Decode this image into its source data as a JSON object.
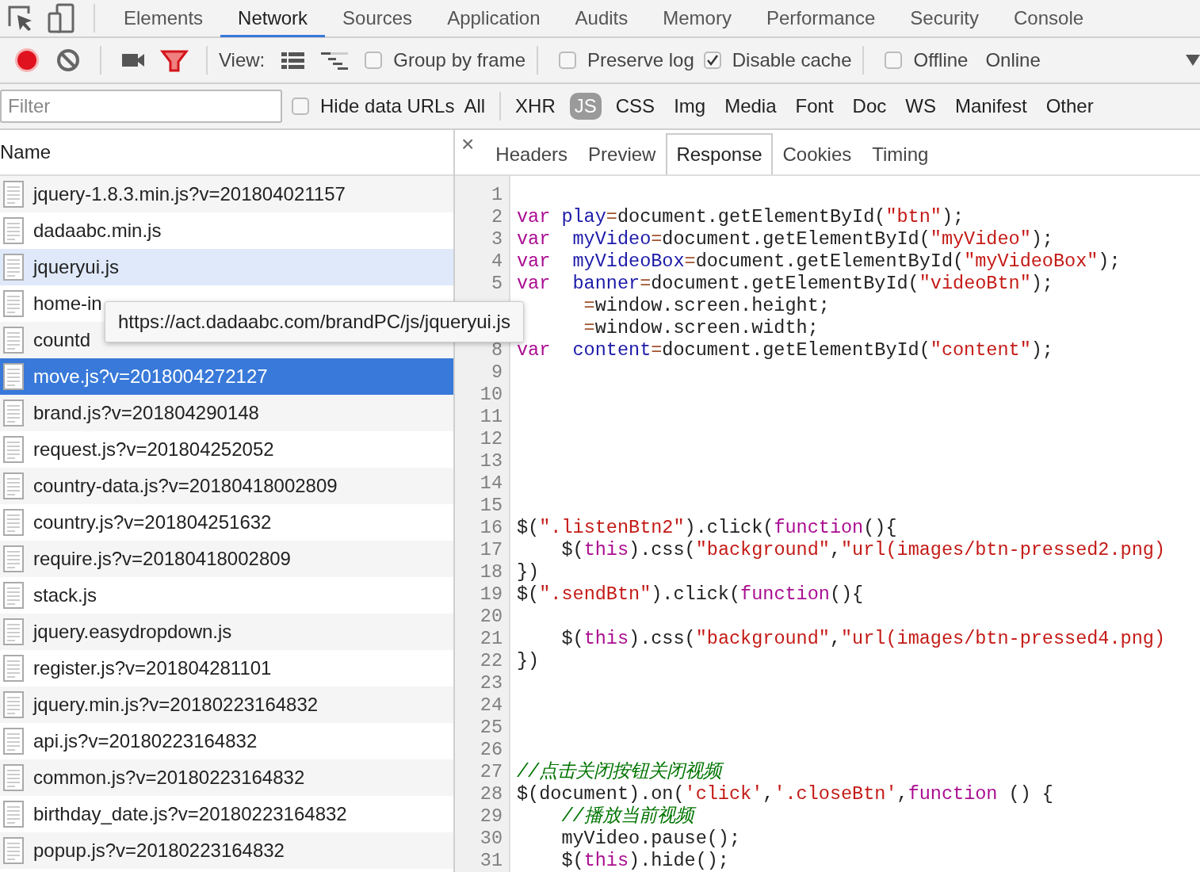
{
  "top_tabs": [
    {
      "label": "Elements",
      "selected": false
    },
    {
      "label": "Network",
      "selected": true
    },
    {
      "label": "Sources",
      "selected": false
    },
    {
      "label": "Application",
      "selected": false
    },
    {
      "label": "Audits",
      "selected": false
    },
    {
      "label": "Memory",
      "selected": false
    },
    {
      "label": "Performance",
      "selected": false
    },
    {
      "label": "Security",
      "selected": false
    },
    {
      "label": "Console",
      "selected": false
    }
  ],
  "toolbar": {
    "view_label": "View:",
    "checkboxes": [
      {
        "label": "Group by frame",
        "checked": false
      },
      {
        "label": "Preserve log",
        "checked": false
      },
      {
        "label": "Disable cache",
        "checked": true
      },
      {
        "label": "Offline",
        "checked": false
      }
    ],
    "throttle": "Online"
  },
  "filter": {
    "placeholder": "Filter",
    "hide_data_urls": {
      "label": "Hide data URLs",
      "checked": false
    },
    "types": [
      {
        "label": "All",
        "selected": false
      },
      {
        "label": "XHR",
        "selected": false
      },
      {
        "label": "JS",
        "selected": true
      },
      {
        "label": "CSS",
        "selected": false
      },
      {
        "label": "Img",
        "selected": false
      },
      {
        "label": "Media",
        "selected": false
      },
      {
        "label": "Font",
        "selected": false
      },
      {
        "label": "Doc",
        "selected": false
      },
      {
        "label": "WS",
        "selected": false
      },
      {
        "label": "Manifest",
        "selected": false
      },
      {
        "label": "Other",
        "selected": false
      }
    ]
  },
  "requests": {
    "column": "Name",
    "rows": [
      {
        "name": "jquery-1.8.3.min.js?v=201804021157",
        "selected": false,
        "hovered": false
      },
      {
        "name": "dadaabc.min.js",
        "selected": false,
        "hovered": false
      },
      {
        "name": "jqueryui.js",
        "selected": false,
        "hovered": true
      },
      {
        "name": "home-in",
        "selected": false,
        "hovered": false
      },
      {
        "name": "countd",
        "selected": false,
        "hovered": false
      },
      {
        "name": "move.js?v=2018004272127",
        "selected": true,
        "hovered": false
      },
      {
        "name": "brand.js?v=201804290148",
        "selected": false,
        "hovered": false
      },
      {
        "name": "request.js?v=201804252052",
        "selected": false,
        "hovered": false
      },
      {
        "name": "country-data.js?v=20180418002809",
        "selected": false,
        "hovered": false
      },
      {
        "name": "country.js?v=201804251632",
        "selected": false,
        "hovered": false
      },
      {
        "name": "require.js?v=20180418002809",
        "selected": false,
        "hovered": false
      },
      {
        "name": "stack.js",
        "selected": false,
        "hovered": false
      },
      {
        "name": "jquery.easydropdown.js",
        "selected": false,
        "hovered": false
      },
      {
        "name": "register.js?v=201804281101",
        "selected": false,
        "hovered": false
      },
      {
        "name": "jquery.min.js?v=20180223164832",
        "selected": false,
        "hovered": false
      },
      {
        "name": "api.js?v=20180223164832",
        "selected": false,
        "hovered": false
      },
      {
        "name": "common.js?v=20180223164832",
        "selected": false,
        "hovered": false
      },
      {
        "name": "birthday_date.js?v=20180223164832",
        "selected": false,
        "hovered": false
      },
      {
        "name": "popup.js?v=20180223164832",
        "selected": false,
        "hovered": false
      }
    ]
  },
  "detail": {
    "close": "×",
    "tabs": [
      {
        "label": "Headers",
        "selected": false
      },
      {
        "label": "Preview",
        "selected": false
      },
      {
        "label": "Response",
        "selected": true
      },
      {
        "label": "Cookies",
        "selected": false
      },
      {
        "label": "Timing",
        "selected": false
      }
    ],
    "code": [
      {
        "number": "1"
      },
      {
        "number": "2",
        "tokens": [
          {
            "kind": "keyword",
            "text": "var"
          },
          {
            "kind": "variable",
            "text": " play"
          },
          {
            "kind": "operator",
            "text": "="
          },
          {
            "kind": "plain",
            "text": "document.getElementById("
          },
          {
            "kind": "string",
            "text": "\"btn\""
          },
          {
            "kind": "plain",
            "text": ");"
          }
        ]
      },
      {
        "number": "3",
        "tokens": [
          {
            "kind": "keyword",
            "text": "var"
          },
          {
            "kind": "variable",
            "text": "  myVideo"
          },
          {
            "kind": "operator",
            "text": "="
          },
          {
            "kind": "plain",
            "text": "document.getElementById("
          },
          {
            "kind": "string",
            "text": "\"myVideo\""
          },
          {
            "kind": "plain",
            "text": ");"
          }
        ]
      },
      {
        "number": "4",
        "tokens": [
          {
            "kind": "keyword",
            "text": "var"
          },
          {
            "kind": "variable",
            "text": "  myVideoBox"
          },
          {
            "kind": "operator",
            "text": "="
          },
          {
            "kind": "plain",
            "text": "document.getElementById("
          },
          {
            "kind": "string",
            "text": "\"myVideoBox\""
          },
          {
            "kind": "plain",
            "text": ");"
          }
        ]
      },
      {
        "number": "5",
        "tokens": [
          {
            "kind": "keyword",
            "text": "var"
          },
          {
            "kind": "variable",
            "text": "  banner"
          },
          {
            "kind": "operator",
            "text": "="
          },
          {
            "kind": "plain",
            "text": "document.getElementById("
          },
          {
            "kind": "string",
            "text": "\"videoBtn\""
          },
          {
            "kind": "plain",
            "text": ");"
          }
        ]
      },
      {
        "kind": "covered",
        "tokens": [
          {
            "kind": "operator",
            "text": "="
          },
          {
            "kind": "plain",
            "text": "window.screen.height;"
          }
        ]
      },
      {
        "kind": "covered",
        "tokens": [
          {
            "kind": "operator",
            "text": "="
          },
          {
            "kind": "plain",
            "text": "window.screen.width;"
          }
        ]
      },
      {
        "number": "8",
        "tokens": [
          {
            "kind": "keyword",
            "text": "var"
          },
          {
            "kind": "variable",
            "text": "  content"
          },
          {
            "kind": "operator",
            "text": "="
          },
          {
            "kind": "plain",
            "text": "document.getElementById("
          },
          {
            "kind": "string",
            "text": "\"content\""
          },
          {
            "kind": "plain",
            "text": ");"
          }
        ]
      },
      {
        "number": "9"
      },
      {
        "number": "10"
      },
      {
        "number": "11"
      },
      {
        "number": "12"
      },
      {
        "number": "13"
      },
      {
        "number": "14"
      },
      {
        "number": "15"
      },
      {
        "number": "16",
        "tokens": [
          {
            "kind": "plain",
            "text": "$("
          },
          {
            "kind": "string",
            "text": "\".listenBtn2\""
          },
          {
            "kind": "plain",
            "text": ").click("
          },
          {
            "kind": "keyword",
            "text": "function"
          },
          {
            "kind": "plain",
            "text": "(){"
          }
        ]
      },
      {
        "number": "17",
        "tokens": [
          {
            "kind": "plain",
            "text": "    $("
          },
          {
            "kind": "keyword",
            "text": "this"
          },
          {
            "kind": "plain",
            "text": ").css("
          },
          {
            "kind": "string",
            "text": "\"background\""
          },
          {
            "kind": "plain",
            "text": ","
          },
          {
            "kind": "string",
            "text": "\"url(images/btn-pressed2.png)"
          }
        ]
      },
      {
        "number": "18",
        "tokens": [
          {
            "kind": "plain",
            "text": "})"
          }
        ]
      },
      {
        "number": "19",
        "tokens": [
          {
            "kind": "plain",
            "text": "$("
          },
          {
            "kind": "string",
            "text": "\".sendBtn\""
          },
          {
            "kind": "plain",
            "text": ").click("
          },
          {
            "kind": "keyword",
            "text": "function"
          },
          {
            "kind": "plain",
            "text": "(){"
          }
        ]
      },
      {
        "number": "20"
      },
      {
        "number": "21",
        "tokens": [
          {
            "kind": "plain",
            "text": "    $("
          },
          {
            "kind": "keyword",
            "text": "this"
          },
          {
            "kind": "plain",
            "text": ").css("
          },
          {
            "kind": "string",
            "text": "\"background\""
          },
          {
            "kind": "plain",
            "text": ","
          },
          {
            "kind": "string",
            "text": "\"url(images/btn-pressed4.png)"
          }
        ]
      },
      {
        "number": "22",
        "tokens": [
          {
            "kind": "plain",
            "text": "})"
          }
        ]
      },
      {
        "number": "23"
      },
      {
        "number": "24"
      },
      {
        "number": "25"
      },
      {
        "number": "26"
      },
      {
        "number": "27",
        "tokens": [
          {
            "kind": "comment",
            "text": "//点击关闭按钮关闭视频"
          }
        ]
      },
      {
        "number": "28",
        "tokens": [
          {
            "kind": "plain",
            "text": "$(document).on("
          },
          {
            "kind": "string",
            "text": "'click'"
          },
          {
            "kind": "plain",
            "text": ","
          },
          {
            "kind": "string",
            "text": "'.closeBtn'"
          },
          {
            "kind": "plain",
            "text": ","
          },
          {
            "kind": "keyword",
            "text": "function"
          },
          {
            "kind": "plain",
            "text": " () {"
          }
        ]
      },
      {
        "number": "29",
        "tokens": [
          {
            "kind": "comment",
            "text": "    //播放当前视频"
          }
        ]
      },
      {
        "number": "30",
        "tokens": [
          {
            "kind": "plain",
            "text": "    myVideo.pause();"
          }
        ]
      },
      {
        "number": "31",
        "tokens": [
          {
            "kind": "plain",
            "text": "    $("
          },
          {
            "kind": "keyword",
            "text": "this"
          },
          {
            "kind": "plain",
            "text": ").hide();"
          }
        ]
      }
    ]
  },
  "tooltip": "https://act.dadaabc.com/brandPC/js/jqueryui.js"
}
